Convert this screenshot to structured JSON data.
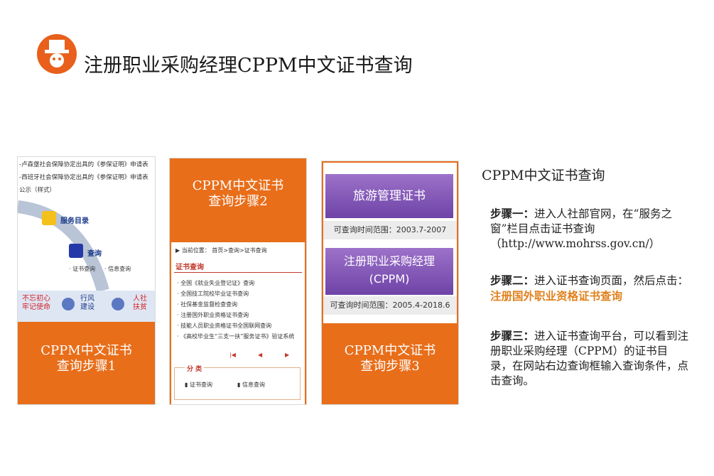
{
  "header": {
    "title": "注册职业采购经理CPPM中文证书查询"
  },
  "panel1": {
    "caption_line1": "CPPM中文证书",
    "caption_line2": "查询步骤1",
    "lines": [
      "-卢森堡社会保障协定出具的《参保证明》申请表",
      "-西班牙社会保障协定出具的《参保证明》申请表",
      "公示（样式）"
    ],
    "service_menu": "服务目录",
    "query_label": "查询",
    "query_sub1": "· 证书查询",
    "query_sub2": "· 信息查询",
    "tiles": [
      {
        "l1": "不忘初心",
        "l2": "牢记使命"
      },
      {
        "l1": "行风",
        "l2": "建设"
      },
      {
        "l1": "人社",
        "l2": "扶贫"
      }
    ]
  },
  "panel2": {
    "caption_line1": "CPPM中文证书",
    "caption_line2": "查询步骤2",
    "breadcrumb": "▶ 当前位置： 首页>查询>证书查询",
    "section_title": "证书查询",
    "items": [
      "· 全国《就业失业登记证》查询",
      "· 全国技工院校毕业证书查询",
      "· 社保基金监督检查查询",
      "· 注册国外职业资格证书查询",
      "· 技能人员职业资格证书全国联网查询",
      "· 《高校毕业生“三支一扶”服务证书》验证系统"
    ],
    "pager": [
      "|◀",
      "◀",
      "▶"
    ],
    "category_title": "分 类",
    "cat1": "证书查询",
    "cat2": "信息查询"
  },
  "panel3": {
    "caption_line1": "CPPM中文证书",
    "caption_line2": "查询步骤3",
    "cert1": "旅游管理证书",
    "range1": "可查询时间范围：2003.7-2007",
    "cert2_l1": "注册职业采购经理",
    "cert2_l2": "(CPPM)",
    "range2": "可查询时间范围：2005.4-2018.6"
  },
  "right": {
    "title": "CPPM中文证书查询",
    "step1_label": "步骤一：",
    "step1_text": "进入人社部官网，在“服务之窗”栏目点击证书查询（http://www.mohrss.gov.cn/）",
    "step2_label": "步骤二：",
    "step2_text": "进入证书查询页面，然后点击：",
    "step2_highlight": "注册国外职业资格证书查询",
    "step3_label": "步骤三：",
    "step3_text": "进入证书查询平台，可以看到注册职业采购经理（CPPM）的证书目录，在网站右边查询框输入查询条件，点击查询。"
  },
  "colors": {
    "orange": "#e86e1a",
    "highlight": "#e0801c",
    "purple": "#7a4fb3"
  }
}
